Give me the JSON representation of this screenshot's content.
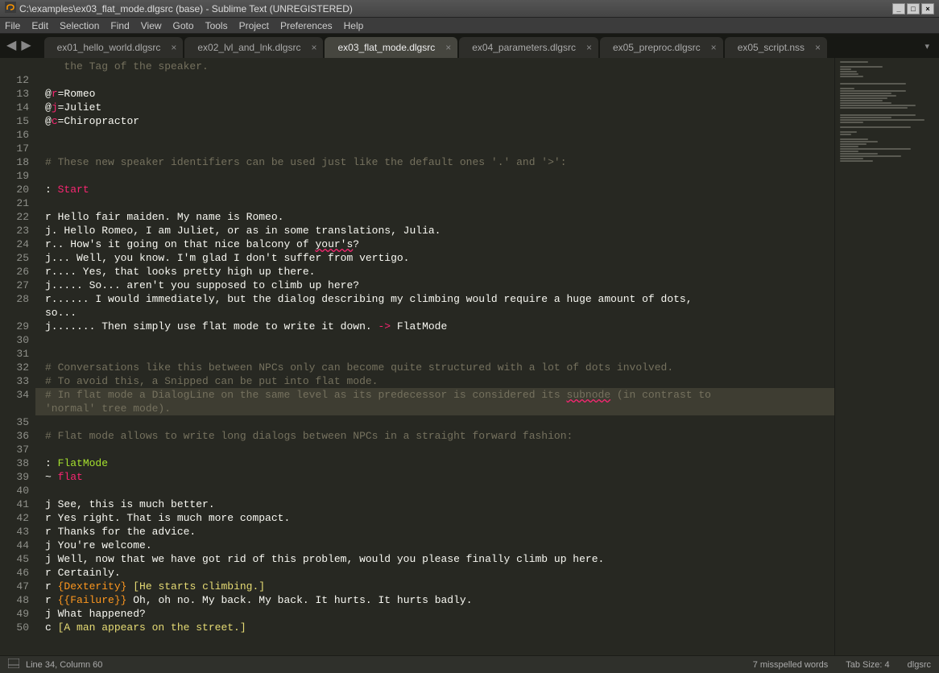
{
  "window": {
    "title": "C:\\examples\\ex03_flat_mode.dlgsrc (base) - Sublime Text (UNREGISTERED)"
  },
  "menu": [
    "File",
    "Edit",
    "Selection",
    "Find",
    "View",
    "Goto",
    "Tools",
    "Project",
    "Preferences",
    "Help"
  ],
  "tabs": [
    {
      "label": "ex01_hello_world.dlgsrc",
      "active": false,
      "closeable": true
    },
    {
      "label": "ex02_lvl_and_lnk.dlgsrc",
      "active": false,
      "closeable": true
    },
    {
      "label": "ex03_flat_mode.dlgsrc",
      "active": true,
      "closeable": true
    },
    {
      "label": "ex04_parameters.dlgsrc",
      "active": false,
      "closeable": true
    },
    {
      "label": "ex05_preproc.dlgsrc",
      "active": false,
      "closeable": true
    },
    {
      "label": "ex05_script.nss",
      "active": false,
      "closeable": true
    }
  ],
  "code": {
    "first_line_no": 12,
    "highlight_line": 34,
    "lines": [
      {
        "tokens": [
          {
            "t": "the Tag of the speaker.",
            "c": "c-comment"
          }
        ],
        "virtual": true,
        "indent": "   "
      },
      {
        "n": 12,
        "tokens": []
      },
      {
        "n": 13,
        "tokens": [
          {
            "t": "@",
            "c": "c-ident"
          },
          {
            "t": "r",
            "c": "c-pink"
          },
          {
            "t": "=Romeo",
            "c": "c-ident"
          }
        ]
      },
      {
        "n": 14,
        "tokens": [
          {
            "t": "@",
            "c": "c-ident"
          },
          {
            "t": "j",
            "c": "c-pink"
          },
          {
            "t": "=Juliet",
            "c": "c-ident"
          }
        ]
      },
      {
        "n": 15,
        "tokens": [
          {
            "t": "@",
            "c": "c-ident"
          },
          {
            "t": "c",
            "c": "c-pink"
          },
          {
            "t": "=Chiropractor",
            "c": "c-ident"
          }
        ]
      },
      {
        "n": 16,
        "tokens": []
      },
      {
        "n": 17,
        "tokens": []
      },
      {
        "n": 18,
        "tokens": [
          {
            "t": "# These new speaker identifiers can be used just like the default ones '.' and '>':",
            "c": "c-comment"
          }
        ]
      },
      {
        "n": 19,
        "tokens": []
      },
      {
        "n": 20,
        "tokens": [
          {
            "t": ": ",
            "c": "c-ident"
          },
          {
            "t": "Start",
            "c": "c-pink"
          }
        ]
      },
      {
        "n": 21,
        "tokens": []
      },
      {
        "n": 22,
        "tokens": [
          {
            "t": "r Hello fair maiden. My name is Romeo.",
            "c": "c-ident"
          }
        ]
      },
      {
        "n": 23,
        "tokens": [
          {
            "t": "j. Hello Romeo, I am Juliet, or as in some translations, Julia.",
            "c": "c-ident"
          }
        ]
      },
      {
        "n": 24,
        "tokens": [
          {
            "t": "r.. How's it going on that nice balcony of ",
            "c": "c-ident"
          },
          {
            "t": "your's",
            "c": "c-ident c-underline"
          },
          {
            "t": "?",
            "c": "c-ident"
          }
        ]
      },
      {
        "n": 25,
        "tokens": [
          {
            "t": "j... Well, you know. I'm glad I don't suffer from vertigo.",
            "c": "c-ident"
          }
        ]
      },
      {
        "n": 26,
        "tokens": [
          {
            "t": "r.... Yes, that looks pretty high up there.",
            "c": "c-ident"
          }
        ]
      },
      {
        "n": 27,
        "tokens": [
          {
            "t": "j..... So... aren't you supposed to climb up here?",
            "c": "c-ident"
          }
        ]
      },
      {
        "n": 28,
        "tokens": [
          {
            "t": "r...... I would immediately, but the dialog describing my climbing would require a huge amount of dots, ",
            "c": "c-ident"
          }
        ]
      },
      {
        "tokens": [
          {
            "t": "so...",
            "c": "c-ident"
          }
        ],
        "virtual": true,
        "indent": ""
      },
      {
        "n": 29,
        "tokens": [
          {
            "t": "j....... Then simply use flat mode to write it down. ",
            "c": "c-ident"
          },
          {
            "t": "->",
            "c": "c-arrow"
          },
          {
            "t": " FlatMode",
            "c": "c-ident"
          }
        ]
      },
      {
        "n": 30,
        "tokens": []
      },
      {
        "n": 31,
        "tokens": []
      },
      {
        "n": 32,
        "tokens": [
          {
            "t": "# Conversations like this between NPCs only can become quite structured with a lot of dots involved.",
            "c": "c-comment"
          }
        ]
      },
      {
        "n": 33,
        "tokens": [
          {
            "t": "# To avoid this, a Snipped can be put into flat mode.",
            "c": "c-comment"
          }
        ]
      },
      {
        "n": 34,
        "tokens": [
          {
            "t": "# In flat mode a DialogLine on the same level as its predecessor is considered its ",
            "c": "c-comment"
          },
          {
            "t": "subnode",
            "c": "c-comment c-underline"
          },
          {
            "t": " (in contrast to ",
            "c": "c-comment"
          }
        ]
      },
      {
        "tokens": [
          {
            "t": "'normal' tree mode).",
            "c": "c-comment"
          }
        ],
        "virtual": true,
        "indent": ""
      },
      {
        "n": 35,
        "tokens": []
      },
      {
        "n": 36,
        "tokens": [
          {
            "t": "# Flat mode allows to write long dialogs between NPCs in a straight forward fashion:",
            "c": "c-comment"
          }
        ]
      },
      {
        "n": 37,
        "tokens": []
      },
      {
        "n": 38,
        "tokens": [
          {
            "t": ": ",
            "c": "c-ident"
          },
          {
            "t": "FlatMode",
            "c": "c-label"
          }
        ]
      },
      {
        "n": 39,
        "tokens": [
          {
            "t": "~ ",
            "c": "c-ident"
          },
          {
            "t": "flat",
            "c": "c-pink"
          }
        ]
      },
      {
        "n": 40,
        "tokens": []
      },
      {
        "n": 41,
        "tokens": [
          {
            "t": "j See, this is much better.",
            "c": "c-ident"
          }
        ]
      },
      {
        "n": 42,
        "tokens": [
          {
            "t": "r Yes right. That is much more compact.",
            "c": "c-ident"
          }
        ]
      },
      {
        "n": 43,
        "tokens": [
          {
            "t": "r Thanks for the advice.",
            "c": "c-ident"
          }
        ]
      },
      {
        "n": 44,
        "tokens": [
          {
            "t": "j You're welcome.",
            "c": "c-ident"
          }
        ]
      },
      {
        "n": 45,
        "tokens": [
          {
            "t": "j Well, now that we have got rid of this problem, would you please finally climb up here.",
            "c": "c-ident"
          }
        ]
      },
      {
        "n": 46,
        "tokens": [
          {
            "t": "r Certainly.",
            "c": "c-ident"
          }
        ]
      },
      {
        "n": 47,
        "tokens": [
          {
            "t": "r ",
            "c": "c-ident"
          },
          {
            "t": "{Dexterity}",
            "c": "c-curly"
          },
          {
            "t": " ",
            "c": "c-ident"
          },
          {
            "t": "[He starts climbing.]",
            "c": "c-sq"
          }
        ]
      },
      {
        "n": 48,
        "tokens": [
          {
            "t": "r ",
            "c": "c-ident"
          },
          {
            "t": "{{Failure}}",
            "c": "c-curly"
          },
          {
            "t": " Oh, oh no. My back. My back. It hurts. It hurts badly.",
            "c": "c-ident"
          }
        ]
      },
      {
        "n": 49,
        "tokens": [
          {
            "t": "j What happened?",
            "c": "c-ident"
          }
        ]
      },
      {
        "n": 50,
        "tokens": [
          {
            "t": "c ",
            "c": "c-ident"
          },
          {
            "t": "[A man appears on the street.]",
            "c": "c-sq"
          }
        ]
      }
    ]
  },
  "status": {
    "position": "Line 34, Column 60",
    "spell": "7 misspelled words",
    "tabsize": "Tab Size: 4",
    "syntax": "dlgsrc"
  },
  "minimap_widths": [
    30,
    0,
    45,
    12,
    18,
    20,
    25,
    0,
    0,
    70,
    0,
    15,
    70,
    55,
    60,
    50,
    45,
    55,
    80,
    72,
    0,
    0,
    80,
    55,
    90,
    25,
    0,
    75,
    0,
    18,
    12,
    0,
    30,
    40,
    28,
    20,
    75,
    20,
    40,
    65,
    25,
    35
  ]
}
